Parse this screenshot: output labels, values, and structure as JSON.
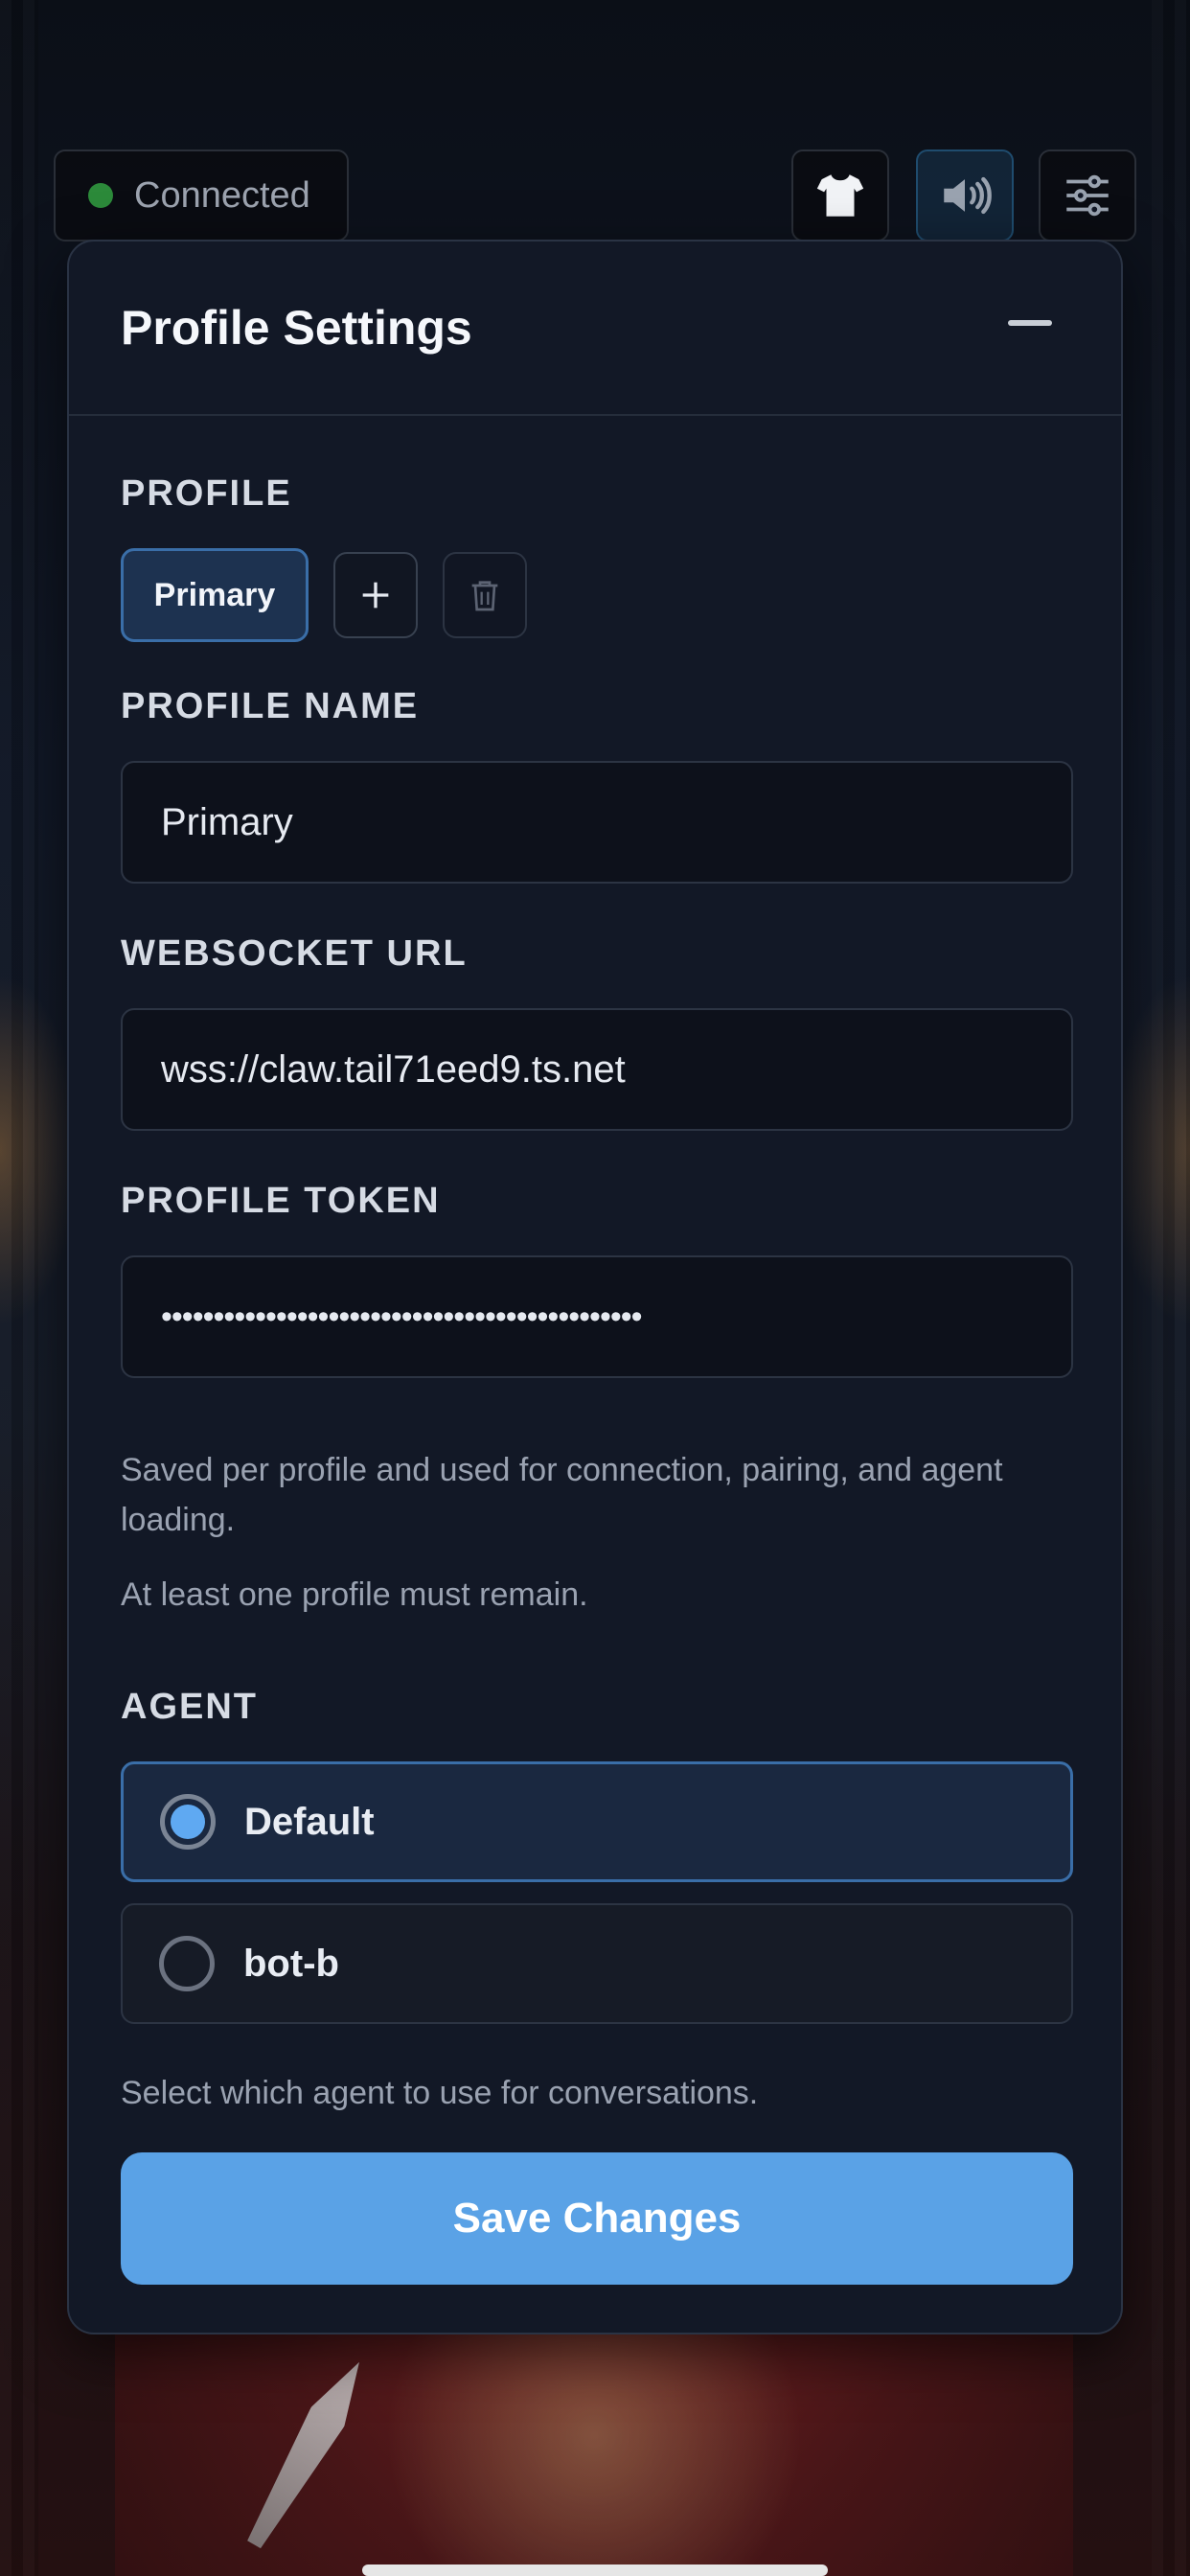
{
  "status": {
    "label": "Connected",
    "color": "#2c8a3a"
  },
  "toolbar": {
    "buttons": [
      {
        "icon": "shirt-icon"
      },
      {
        "icon": "speaker-icon"
      },
      {
        "icon": "sliders-icon"
      }
    ]
  },
  "panel": {
    "title": "Profile Settings",
    "profile_section": {
      "label": "PROFILE",
      "active_profile": "Primary"
    },
    "profile_name": {
      "label": "PROFILE NAME",
      "value": "Primary"
    },
    "websocket_url": {
      "label": "WEBSOCKET URL",
      "value": "wss://claw.tail71eed9.ts.net"
    },
    "profile_token": {
      "label": "PROFILE TOKEN",
      "value": "••••••••••••••••••••••••••••••••••••••••••••••"
    },
    "help": {
      "line1": "Saved per profile and used for connection, pairing, and agent loading.",
      "line2": "At least one profile must remain."
    },
    "agent": {
      "label": "AGENT",
      "options": [
        {
          "label": "Default",
          "selected": true
        },
        {
          "label": "bot-b",
          "selected": false
        }
      ],
      "help": "Select which agent to use for conversations."
    },
    "save_label": "Save Changes"
  },
  "colors": {
    "accent": "#5aa2e6",
    "panel_bg": "#121826",
    "selected_border": "#3a6ea8"
  }
}
